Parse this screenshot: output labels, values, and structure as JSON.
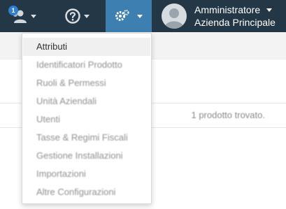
{
  "header": {
    "notifications_count": "1",
    "user": {
      "name": "Amministratore",
      "company": "Azienda Principale"
    }
  },
  "settings_menu": {
    "items": [
      {
        "label": "Attributi",
        "active": true
      },
      {
        "label": "Identificatori Prodotto"
      },
      {
        "label": "Ruoli & Permessi"
      },
      {
        "label": "Unità Aziendali"
      },
      {
        "label": "Utenti"
      },
      {
        "label": "Tasse & Regimi Fiscali"
      },
      {
        "label": "Gestione Installazioni"
      },
      {
        "label": "Importazioni"
      },
      {
        "label": "Altre Configurazioni"
      }
    ]
  },
  "results": {
    "found_text": "1 prodotto trovato."
  },
  "colors": {
    "topbar": "#243746",
    "active_nav": "#3c7fb0",
    "badge": "#2f7fd3"
  },
  "icons": [
    "users-icon",
    "help-icon",
    "gears-icon",
    "chevron-down-icon",
    "avatar-icon"
  ]
}
